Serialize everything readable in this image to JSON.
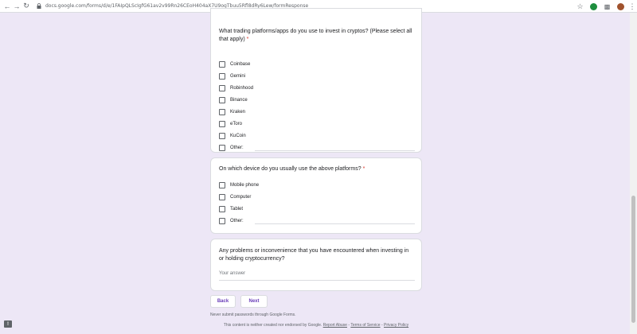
{
  "browser": {
    "url": "docs.google.com/forms/d/e/1FAIpQLScIgfG61av2v99Rn26CEoH404aX7U9ogTbuu5Rfl8dRy6Lew/formResponse"
  },
  "questions": [
    {
      "title": "What trading platforms/apps do you use to invest in cryptos? (Please select all that apply)",
      "required_mark": "*",
      "options": [
        "Coinbase",
        "Gemini",
        "Robinhood",
        "Binance",
        "Kraken",
        "eToro",
        "KuCoin",
        "Other:"
      ]
    },
    {
      "title": "On which device do you usually use the above platforms?",
      "required_mark": "*",
      "options": [
        "Mobile phone",
        "Computer",
        "Tablet",
        "Other:"
      ]
    },
    {
      "title": "Any problems or inconvenience that you have encountered when investing in or holding cryptocurrency?",
      "answer_placeholder": "Your answer"
    }
  ],
  "buttons": {
    "back": "Back",
    "next": "Next"
  },
  "footer": {
    "never_submit": "Never submit passwords through Google Forms.",
    "disclaimer": "This content is neither created nor endorsed by Google.",
    "report_abuse": "Report Abuse",
    "sep1": " - ",
    "terms": "Terms of Service",
    "sep2": " - ",
    "privacy": "Privacy Policy"
  },
  "colors": {
    "background": "#ede7f6",
    "accent": "#673ab7",
    "required": "#d93025"
  }
}
